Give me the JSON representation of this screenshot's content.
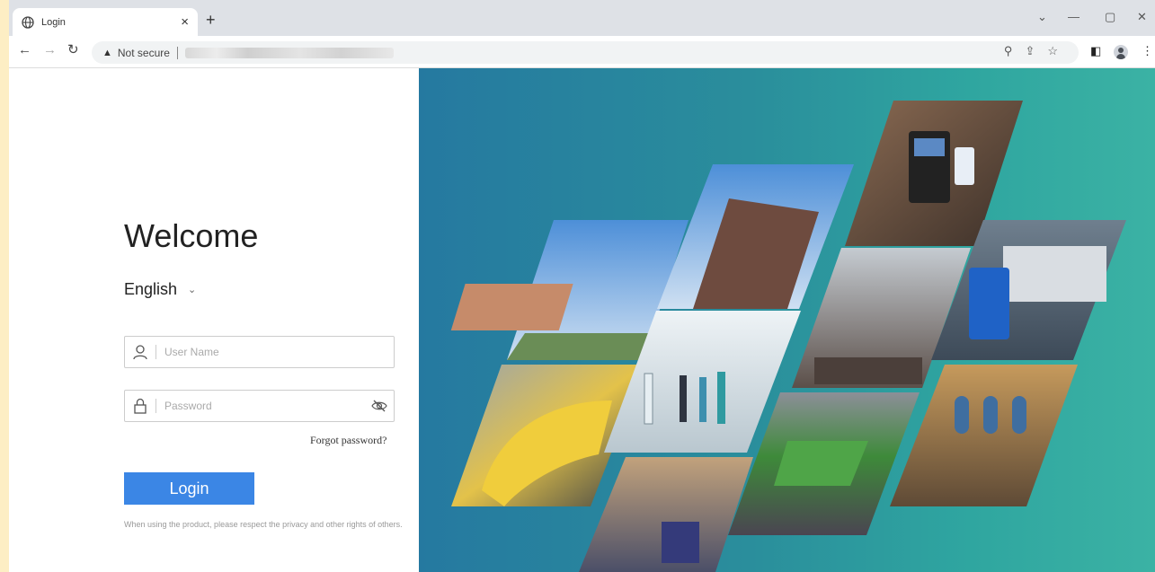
{
  "browser": {
    "tab_title": "Login",
    "new_tab": "+",
    "security_label": "Not secure",
    "window_controls": [
      "⌄",
      "—",
      "▢",
      "✕"
    ]
  },
  "login": {
    "welcome": "Welcome",
    "language": "English",
    "username_placeholder": "User Name",
    "password_placeholder": "Password",
    "forgot_password": "Forgot password?",
    "login_button": "Login",
    "privacy_notice": "When using the product, please respect the privacy and other rights of others."
  },
  "icons": {
    "tab": "globe-icon",
    "username": "user-icon",
    "password": "lock-icon",
    "visibility": "eye-off-icon"
  },
  "colors": {
    "accent": "#3b86e5",
    "panel_from": "#2579a0",
    "panel_to": "#3bb2a4"
  }
}
